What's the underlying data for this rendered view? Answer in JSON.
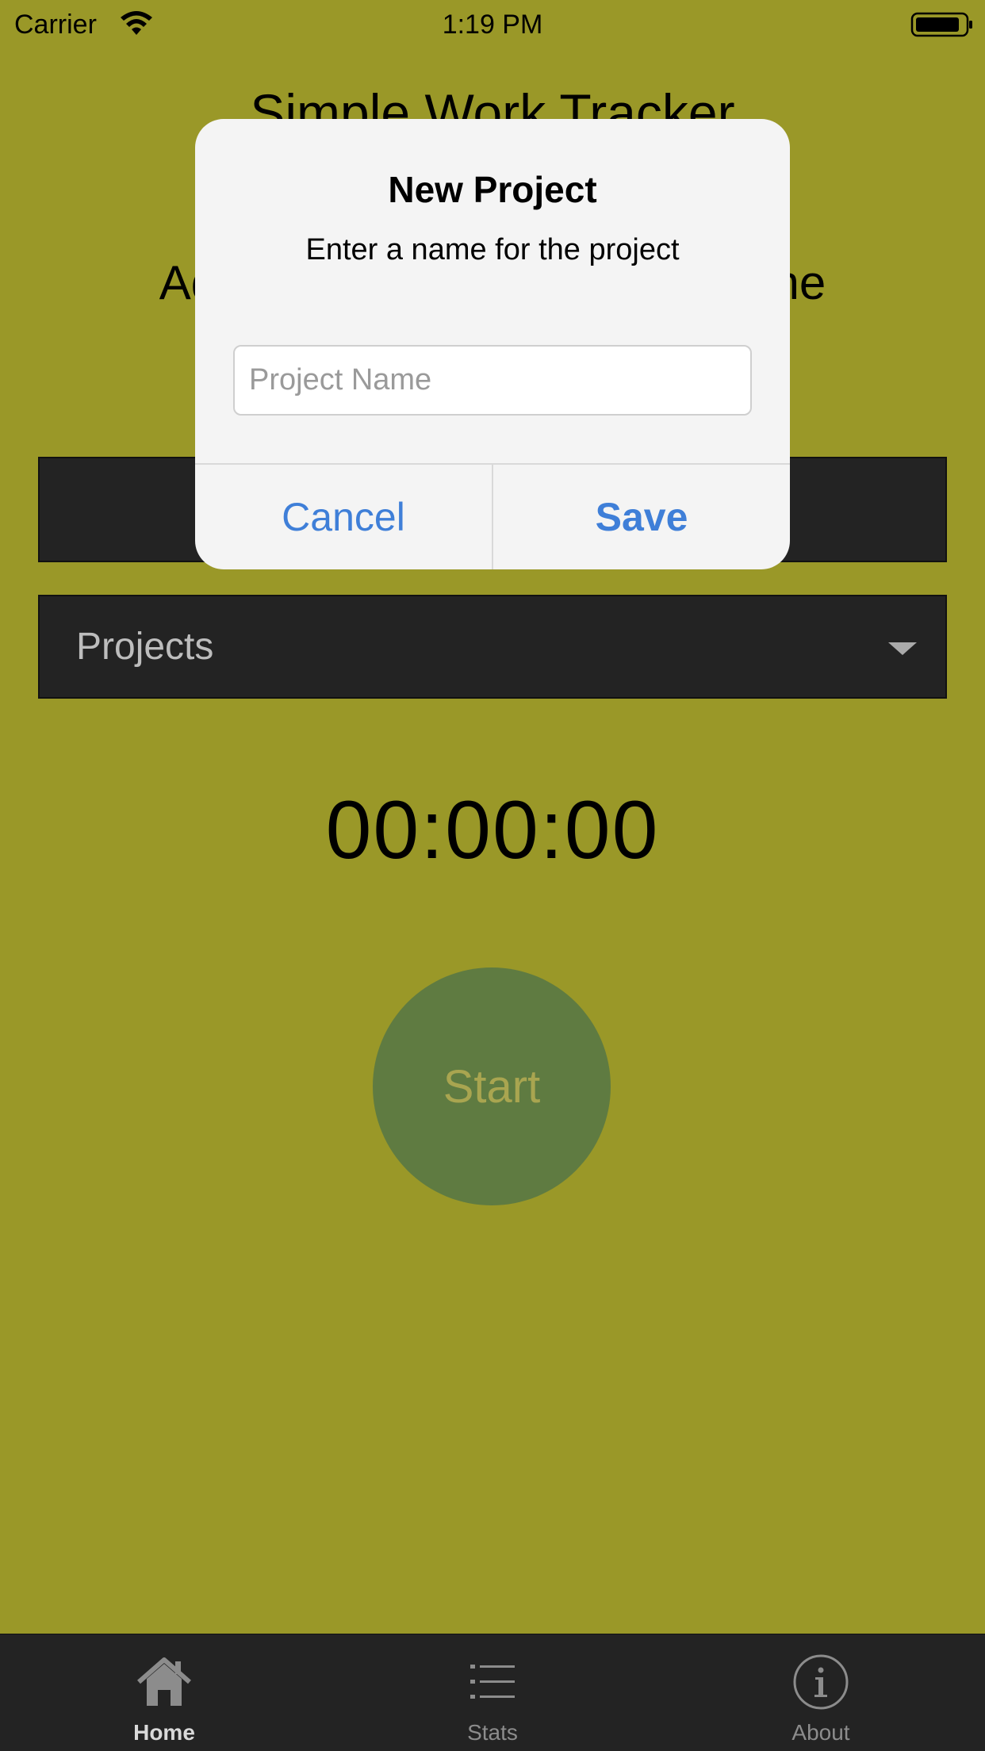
{
  "status_bar": {
    "carrier": "Carrier",
    "time": "1:19 PM"
  },
  "app": {
    "title": "Simple Work Tracker",
    "instructions": "Add a new project or select one",
    "projects_dropdown": "Projects",
    "timer": "00:00:00",
    "start_button": "Start"
  },
  "alert": {
    "title": "New Project",
    "message": "Enter a name for the project",
    "input_placeholder": "Project Name",
    "input_value": "",
    "cancel": "Cancel",
    "save": "Save"
  },
  "tabs": [
    {
      "label": "Home",
      "icon": "home-icon",
      "active": true
    },
    {
      "label": "Stats",
      "icon": "list-icon",
      "active": false
    },
    {
      "label": "About",
      "icon": "info-icon",
      "active": false
    }
  ],
  "colors": {
    "background": "#9a9828",
    "dark_panel": "#232323",
    "start_button": "#5f7b41",
    "alert_button": "#3f7fd8"
  }
}
